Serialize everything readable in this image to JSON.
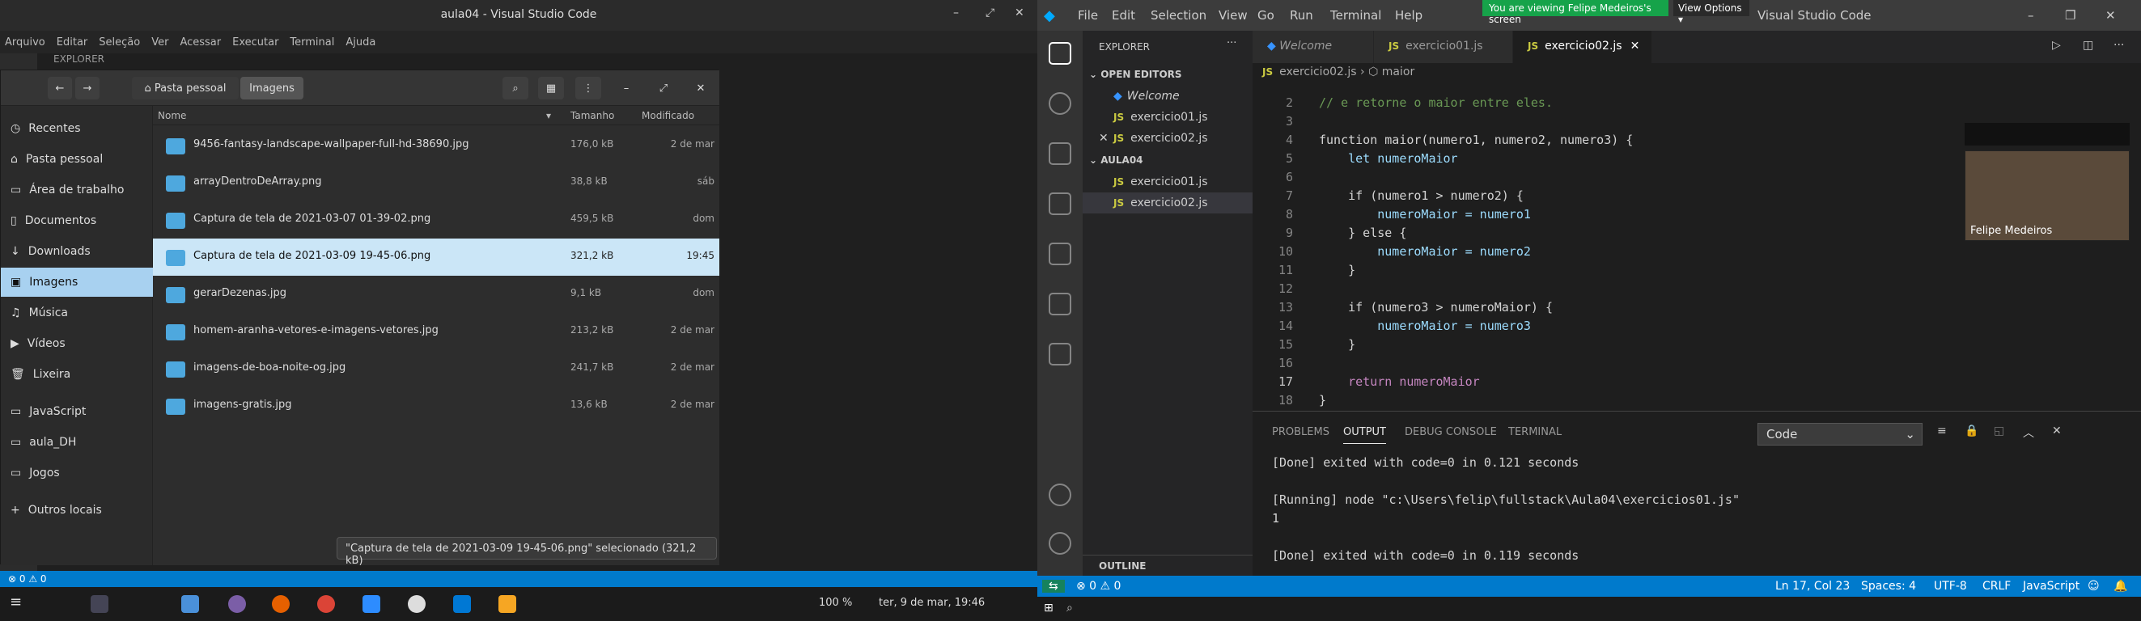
{
  "left": {
    "title": "aula04 - Visual Studio Code",
    "menu": [
      "Arquivo",
      "Editar",
      "Seleção",
      "Ver",
      "Acessar",
      "Executar",
      "Terminal",
      "Ajuda"
    ],
    "explorer_label": "EXPLORER",
    "fm": {
      "crumb_home": "Pasta pessoal",
      "crumb_current": "Imagens",
      "sidebar": [
        "Recentes",
        "Pasta pessoal",
        "Área de trabalho",
        "Documentos",
        "Downloads",
        "Imagens",
        "Música",
        "Vídeos",
        "Lixeira",
        "JavaScript",
        "aula_DH",
        "Jogos",
        "Outros locais"
      ],
      "columns": {
        "name": "Nome",
        "size": "Tamanho",
        "modified": "Modificado"
      },
      "files": [
        {
          "name": "9456-fantasy-landscape-wallpaper-full-hd-38690.jpg",
          "size": "176,0 kB",
          "modified": "2 de mar"
        },
        {
          "name": "arrayDentroDeArray.png",
          "size": "38,8 kB",
          "modified": "sáb"
        },
        {
          "name": "Captura de tela de 2021-03-07 01-39-02.png",
          "size": "459,5 kB",
          "modified": "dom"
        },
        {
          "name": "Captura de tela de 2021-03-09 19-45-06.png",
          "size": "321,2 kB",
          "modified": "19:45"
        },
        {
          "name": "gerarDezenas.jpg",
          "size": "9,1 kB",
          "modified": "dom"
        },
        {
          "name": "homem-aranha-vetores-e-imagens-vetores.jpg",
          "size": "213,2 kB",
          "modified": "2 de mar"
        },
        {
          "name": "imagens-de-boa-noite-og.jpg",
          "size": "241,7 kB",
          "modified": "2 de mar"
        },
        {
          "name": "imagens-gratis.jpg",
          "size": "13,6 kB",
          "modified": "2 de mar"
        }
      ],
      "status": "\"Captura de tela de 2021-03-09 19-45-06.png\" selecionado (321,2 kB)"
    },
    "statusbar": "⊗ 0 ⚠ 0",
    "taskbar": {
      "volume": "100 %",
      "clock": "ter, 9 de mar, 19:46"
    }
  },
  "right": {
    "menu": [
      "File",
      "Edit",
      "Selection",
      "View",
      "Go",
      "Run",
      "Terminal",
      "Help"
    ],
    "share_banner": "You are viewing Felipe Medeiros's screen",
    "view_options": "View Options ▾",
    "title_tail": "Visual Studio Code",
    "explorer": "EXPLORER",
    "open_editors": "OPEN EDITORS",
    "open_files": [
      "Welcome",
      "exercicio01.js",
      "exercicio02.js"
    ],
    "folder": "AULA04",
    "folder_files": [
      "exercicio01.js",
      "exercicio02.js"
    ],
    "outline": "OUTLINE",
    "tabs": [
      "Welcome",
      "exercicio01.js",
      "exercicio02.js"
    ],
    "crumb_file": "exercicio02.js",
    "crumb_sym": "maior",
    "code": [
      {
        "n": "2",
        "t": "// e retorne o maior entre eles."
      },
      {
        "n": "3",
        "t": ""
      },
      {
        "n": "4",
        "t": "function maior(numero1, numero2, numero3) {"
      },
      {
        "n": "5",
        "t": "    let numeroMaior"
      },
      {
        "n": "6",
        "t": ""
      },
      {
        "n": "7",
        "t": "    if (numero1 > numero2) {"
      },
      {
        "n": "8",
        "t": "        numeroMaior = numero1"
      },
      {
        "n": "9",
        "t": "    } else {"
      },
      {
        "n": "10",
        "t": "        numeroMaior = numero2"
      },
      {
        "n": "11",
        "t": "    }"
      },
      {
        "n": "12",
        "t": ""
      },
      {
        "n": "13",
        "t": "    if (numero3 > numeroMaior) {"
      },
      {
        "n": "14",
        "t": "        numeroMaior = numero3"
      },
      {
        "n": "15",
        "t": "    }"
      },
      {
        "n": "16",
        "t": ""
      },
      {
        "n": "17",
        "t": "    return numeroMaior"
      },
      {
        "n": "18",
        "t": "}"
      }
    ],
    "cam_name": "Felipe Medeiros",
    "panel_tabs": [
      "PROBLEMS",
      "OUTPUT",
      "DEBUG CONSOLE",
      "TERMINAL"
    ],
    "output_channel": "Code",
    "output": [
      "[Done] exited with code=0 in 0.121 seconds",
      "",
      "[Running] node \"c:\\Users\\felip\\fullstack\\Aula04\\exercicios01.js\"",
      "1",
      "",
      "[Done] exited with code=0 in 0.119 seconds"
    ],
    "status": {
      "errors": "⊗ 0 ⚠ 0",
      "pos": "Ln 17, Col 23",
      "spaces": "Spaces: 4",
      "enc": "UTF-8",
      "eol": "CRLF",
      "lang": "JavaScript"
    },
    "accent": "#007acc"
  }
}
